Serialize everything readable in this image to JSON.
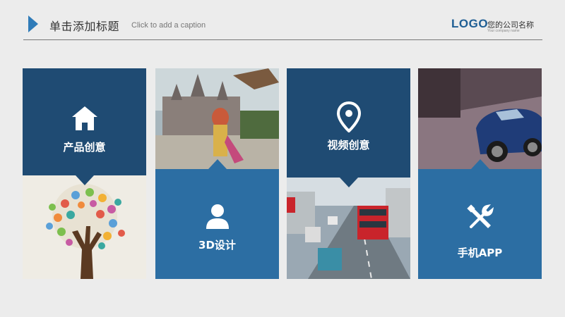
{
  "header": {
    "title": "单击添加标题",
    "caption": "Click to add a caption",
    "logo": "LOGO",
    "company_cn": "您的公司名称",
    "company_en": "Your company name"
  },
  "tiles": [
    {
      "label": "产品创意",
      "icon": "home-icon"
    },
    {
      "label": "3D设计",
      "icon": "user-icon"
    },
    {
      "label": "视频创意",
      "icon": "location-pin-icon"
    },
    {
      "label": "手机APP",
      "icon": "tools-icon"
    }
  ],
  "images": [
    "handprint-tree-image",
    "castle-travel-photo",
    "city-street-bus-photo",
    "sports-car-photo"
  ],
  "colors": {
    "accent": "#2f7bb8",
    "navy": "#1f4b73",
    "blue": "#2c6ea3",
    "background": "#ececec"
  }
}
